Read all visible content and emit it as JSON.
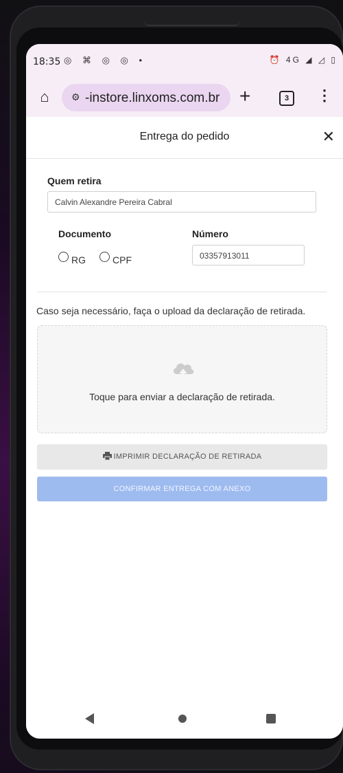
{
  "statusbar": {
    "time": "18:35",
    "left_icons": "◎ ⌘ ◎ ◎ •",
    "right_icons": "⏰ 4G ◢ ◿ ▯"
  },
  "browser": {
    "url": "-instore.linxoms.com.br",
    "tab_count": "3"
  },
  "modal": {
    "title": "Entrega do pedido",
    "close_symbol": "✕"
  },
  "form": {
    "quem_retira_label": "Quem retira",
    "quem_retira_value": "Calvin Alexandre Pereira Cabral",
    "documento_label": "Documento",
    "numero_label": "Número",
    "numero_value": "03357913011",
    "options": [
      {
        "label": "RG",
        "selected": false
      },
      {
        "label": "CPF",
        "selected": false
      }
    ]
  },
  "upload": {
    "hint": "Caso seja necessário, faça o upload da declaração de retirada.",
    "dropzone_text": "Toque para enviar a declaração de retirada."
  },
  "buttons": {
    "print_label": "IMPRIMIR DECLARAÇÃO DE RETIRADA",
    "confirm_label": "CONFIRMAR ENTREGA COM ANEXO"
  },
  "colors": {
    "browser_chrome": "#f7edf7",
    "url_pill": "#ead6f0",
    "confirm_button": "#9ebbef",
    "print_button": "#e8e8e8"
  }
}
